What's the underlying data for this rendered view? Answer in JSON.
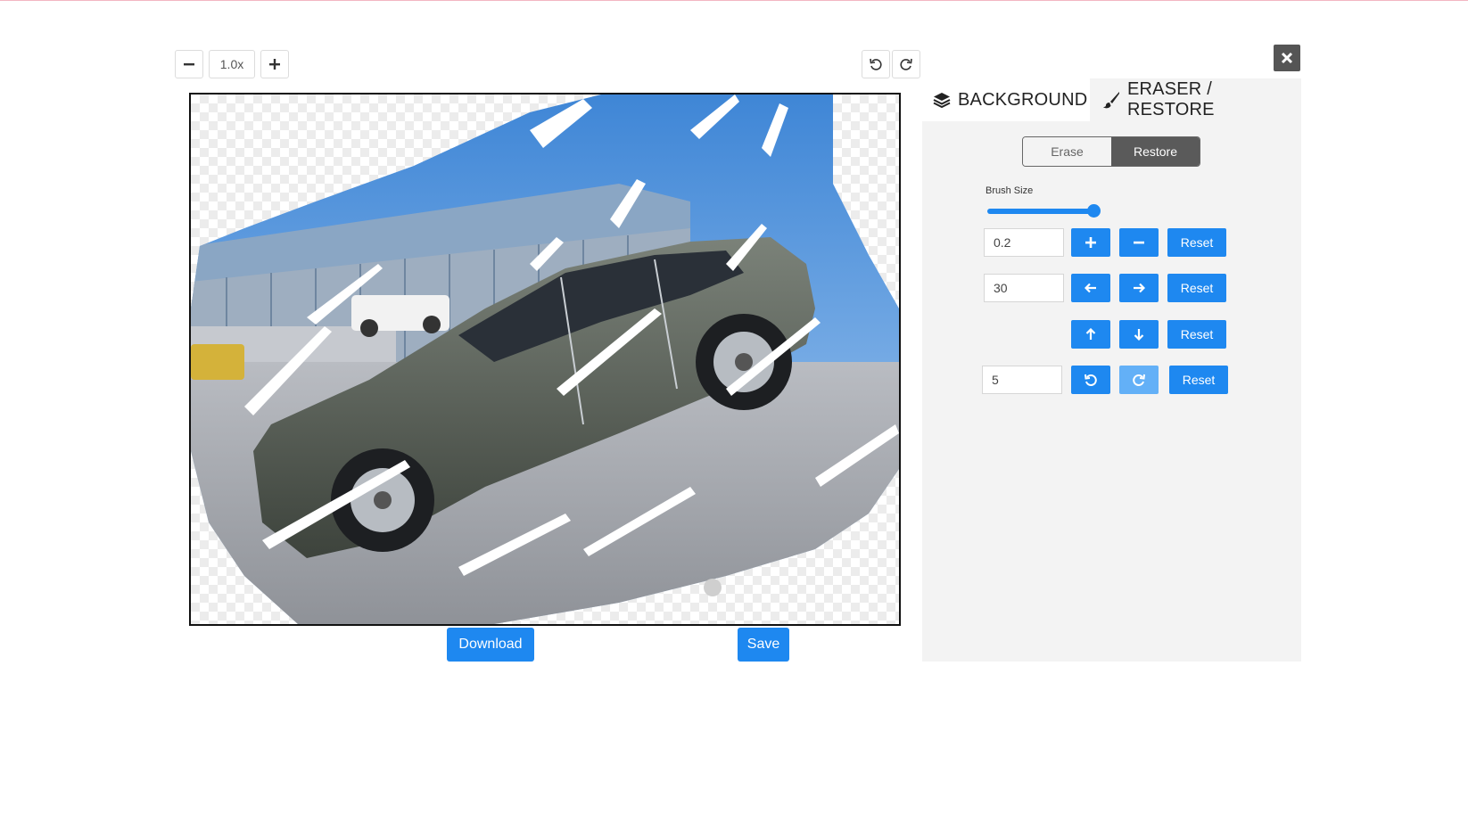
{
  "zoom": {
    "value": "1.0x"
  },
  "actions": {
    "download_label": "Download",
    "save_label": "Save"
  },
  "tabs": [
    {
      "label": "BACKGROUND",
      "icon": "layers-icon"
    },
    {
      "label": "ERASER / RESTORE",
      "icon": "brush-icon"
    }
  ],
  "mode": {
    "erase_label": "Erase",
    "restore_label": "Restore",
    "selected": "Restore"
  },
  "brush": {
    "label": "Brush Size",
    "level": 0.95
  },
  "controls": {
    "scale_value": "0.2",
    "horizontal_value": "30",
    "rotate_value": "5",
    "reset_label": "Reset"
  },
  "colors": {
    "accent": "#1e88f0",
    "panel_bg": "#f3f3f3",
    "segment_active": "#5a5a5a"
  }
}
